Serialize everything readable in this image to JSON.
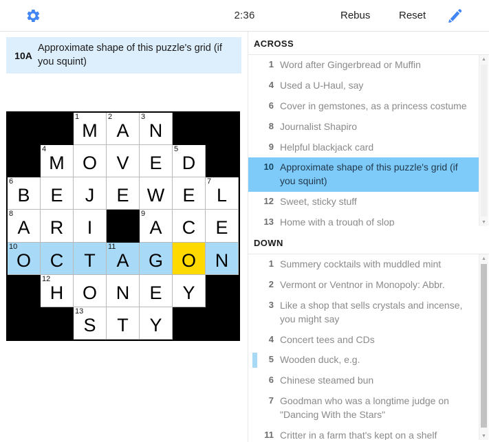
{
  "toolbar": {
    "gear_icon": "gear-icon",
    "timer": "2:36",
    "rebus_label": "Rebus",
    "reset_label": "Reset",
    "pencil_icon": "pencil-icon",
    "accent_color": "#4285f4"
  },
  "current_clue": {
    "number": "10A",
    "text": "Approximate shape of this puzzle's grid (if you squint)"
  },
  "grid": {
    "rows": 7,
    "cols": 7,
    "highlight_color": "#a8d9f7",
    "cursor_color": "#ffd900",
    "cells": [
      [
        {
          "block": true
        },
        {
          "block": true
        },
        {
          "num": "1",
          "letter": "M"
        },
        {
          "num": "2",
          "letter": "A"
        },
        {
          "num": "3",
          "letter": "N"
        },
        {
          "block": true
        },
        {
          "block": true
        }
      ],
      [
        {
          "block": true
        },
        {
          "num": "4",
          "letter": "M"
        },
        {
          "letter": "O"
        },
        {
          "letter": "V"
        },
        {
          "letter": "E"
        },
        {
          "num": "5",
          "letter": "D"
        },
        {
          "block": true
        }
      ],
      [
        {
          "num": "6",
          "letter": "B"
        },
        {
          "letter": "E"
        },
        {
          "letter": "J"
        },
        {
          "letter": "E"
        },
        {
          "letter": "W"
        },
        {
          "letter": "E"
        },
        {
          "num": "7",
          "letter": "L"
        }
      ],
      [
        {
          "num": "8",
          "letter": "A"
        },
        {
          "letter": "R"
        },
        {
          "letter": "I"
        },
        {
          "block": true
        },
        {
          "num": "9",
          "letter": "A"
        },
        {
          "letter": "C"
        },
        {
          "letter": "E"
        }
      ],
      [
        {
          "num": "10",
          "letter": "O",
          "hl": true
        },
        {
          "letter": "C",
          "hl": true
        },
        {
          "letter": "T",
          "hl": true
        },
        {
          "num": "11",
          "letter": "A",
          "hl": true
        },
        {
          "letter": "G",
          "hl": true
        },
        {
          "letter": "O",
          "cursor": true
        },
        {
          "letter": "N",
          "hl": true
        }
      ],
      [
        {
          "block": true
        },
        {
          "num": "12",
          "letter": "H"
        },
        {
          "letter": "O"
        },
        {
          "letter": "N"
        },
        {
          "letter": "E"
        },
        {
          "letter": "Y"
        },
        {
          "block": true
        }
      ],
      [
        {
          "block": true
        },
        {
          "block": true
        },
        {
          "num": "13",
          "letter": "S"
        },
        {
          "letter": "T"
        },
        {
          "letter": "Y"
        },
        {
          "block": true
        },
        {
          "block": true
        }
      ]
    ]
  },
  "across": {
    "heading": "ACROSS",
    "clues": [
      {
        "num": "1",
        "text": "Word after Gingerbread or Muffin"
      },
      {
        "num": "4",
        "text": "Used a U-Haul, say"
      },
      {
        "num": "6",
        "text": "Cover in gemstones, as a princess costume"
      },
      {
        "num": "8",
        "text": "Journalist Shapiro"
      },
      {
        "num": "9",
        "text": "Helpful blackjack card"
      },
      {
        "num": "10",
        "text": "Approximate shape of this puzzle's grid (if you squint)",
        "active": true
      },
      {
        "num": "12",
        "text": "Sweet, sticky stuff"
      },
      {
        "num": "13",
        "text": "Home with a trough of slop"
      }
    ]
  },
  "down": {
    "heading": "DOWN",
    "clues": [
      {
        "num": "1",
        "text": "Summery cocktails with muddled mint"
      },
      {
        "num": "2",
        "text": "Vermont or Ventnor in Monopoly: Abbr."
      },
      {
        "num": "3",
        "text": "Like a shop that sells crystals and incense, you might say"
      },
      {
        "num": "4",
        "text": "Concert tees and CDs"
      },
      {
        "num": "5",
        "text": "Wooden duck, e.g.",
        "anchor": true
      },
      {
        "num": "6",
        "text": "Chinese steamed bun"
      },
      {
        "num": "7",
        "text": "Goodman who was a longtime judge on \"Dancing With the Stars\""
      },
      {
        "num": "11",
        "text": "Critter in a farm that's kept on a shelf"
      }
    ]
  }
}
